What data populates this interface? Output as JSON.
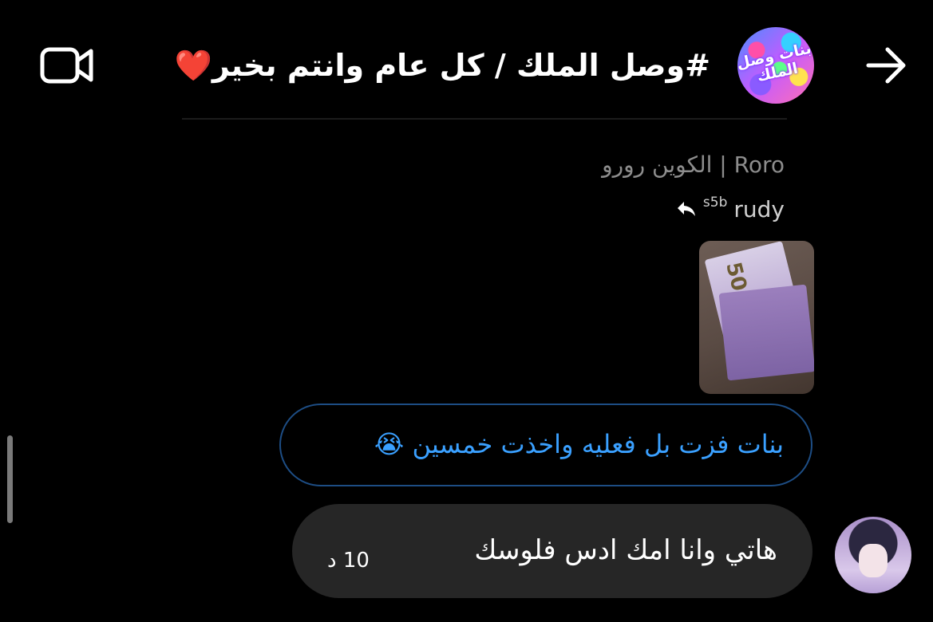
{
  "header": {
    "title": "#وصل الملك / كل عام وانتم بخير",
    "title_emoji": "❤️",
    "group_avatar_text": "بنات وصل الملك"
  },
  "message_meta": {
    "sender_name": "الكوين رورو | Roro",
    "reply_to": "rudy",
    "reply_suffix": "s5b"
  },
  "messages": [
    {
      "kind": "image",
      "image_label": "50"
    },
    {
      "kind": "text-outlined",
      "text": "بنات فزت بل فعليه واخذت خمسين 😭"
    },
    {
      "kind": "text",
      "text": "هاتي وانا امك ادس فلوسك",
      "time": "10 د"
    }
  ],
  "colors": {
    "background": "#000000",
    "outline_bubble_border": "#1d4d84",
    "outline_bubble_text": "#3aa0ff",
    "dark_bubble": "#262626",
    "heart": "#e21d2c"
  },
  "icons": {
    "video": "video-camera-icon",
    "back": "arrow-right-icon",
    "reply": "reply-arrow-icon"
  }
}
